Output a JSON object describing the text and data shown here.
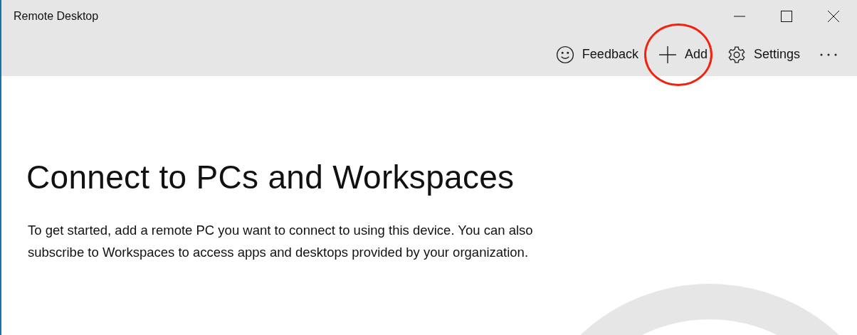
{
  "window": {
    "title": "Remote Desktop"
  },
  "toolbar": {
    "items": [
      {
        "kind": "feedback",
        "label": "Feedback",
        "highlighted": false
      },
      {
        "kind": "add",
        "label": "Add",
        "highlighted": true
      },
      {
        "kind": "settings",
        "label": "Settings",
        "highlighted": false
      },
      {
        "kind": "more"
      }
    ]
  },
  "content": {
    "heading": "Connect to PCs and Workspaces",
    "description": "To get started, add a remote PC you want to connect to using this device. You can also subscribe to Workspaces to access apps and desktops provided by your organization."
  }
}
